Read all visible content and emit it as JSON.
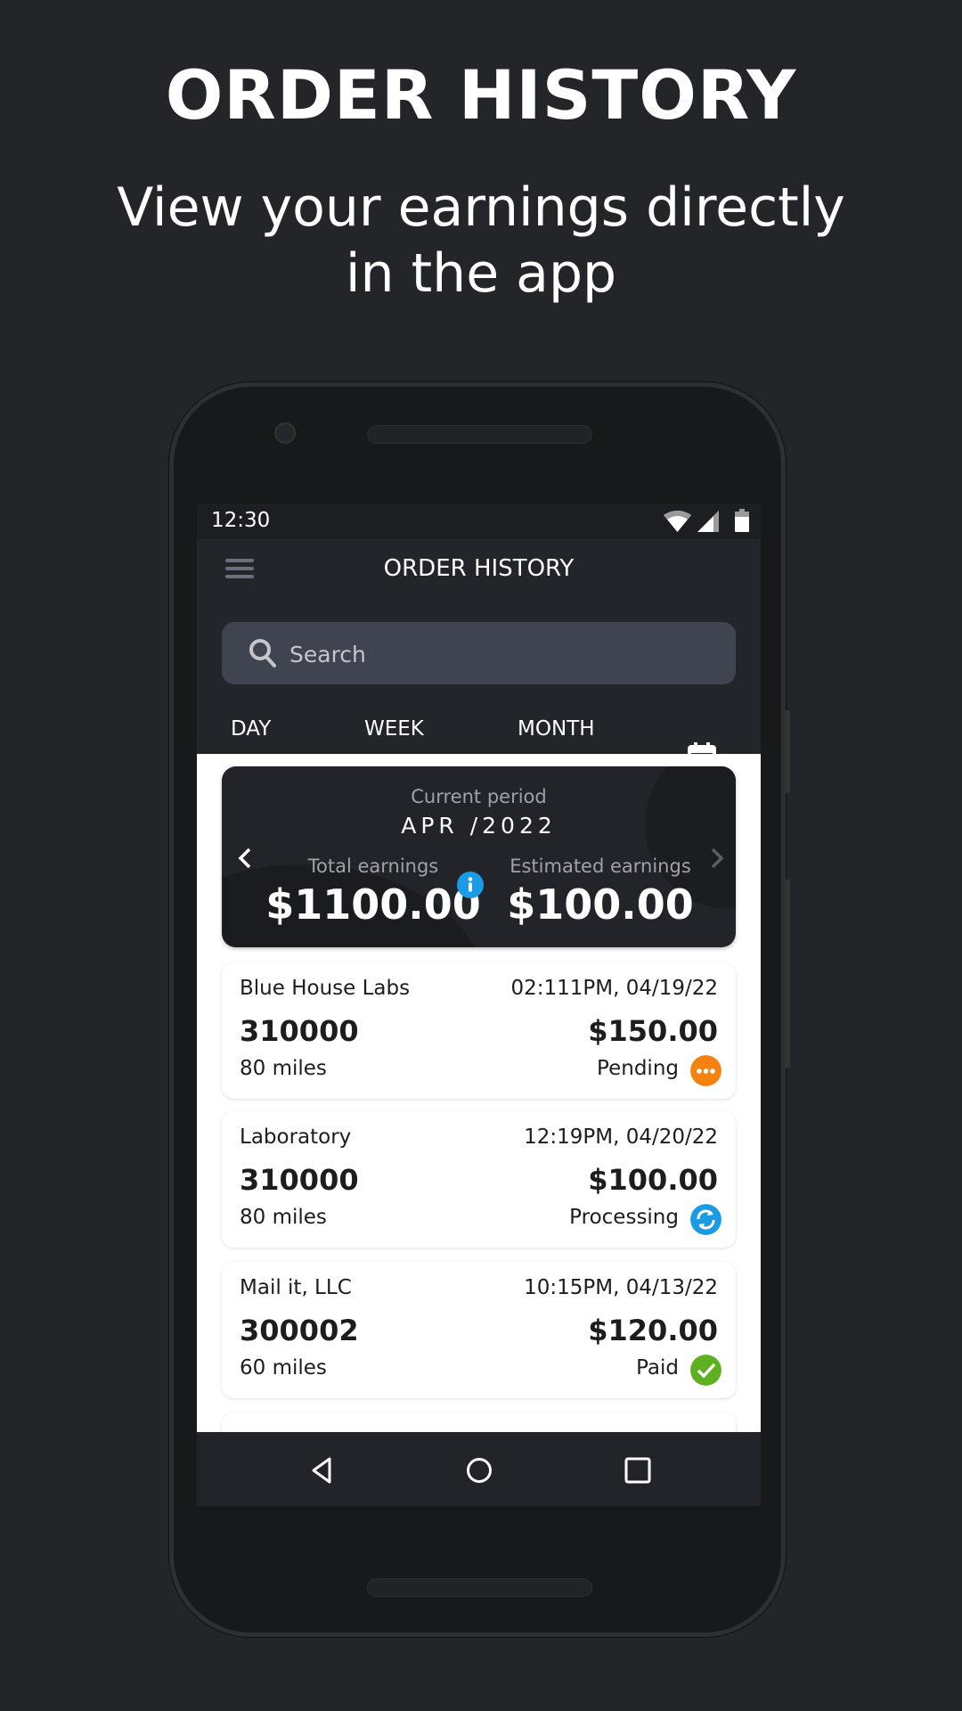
{
  "promo": {
    "headline": "ORDER HISTORY",
    "subline_1": "View your earnings directly",
    "subline_2": "in the app"
  },
  "status_bar": {
    "time": "12:30",
    "icons": [
      "wifi-icon",
      "signal-icon",
      "battery-icon"
    ]
  },
  "app_bar": {
    "title": "ORDER HISTORY",
    "menu_icon": "hamburger-menu-icon"
  },
  "search": {
    "placeholder": "Search",
    "value": ""
  },
  "tabs": [
    {
      "label": "DAY",
      "active": false
    },
    {
      "label": "WEEK",
      "active": false
    },
    {
      "label": "MONTH",
      "active": true
    }
  ],
  "calendar_icon": "calendar-icon",
  "summary": {
    "period_label": "Current period",
    "period_value": "APR /2022",
    "total_label": "Total earnings",
    "total_value": "$1100.00",
    "estimated_label": "Estimated earnings",
    "estimated_value": "$100.00"
  },
  "orders": [
    {
      "name": "Blue House Labs",
      "time": "02:111PM, 04/19/22",
      "id": "310000",
      "amount": "$150.00",
      "miles": "80 miles",
      "status": "Pending",
      "status_color": "#f5820f"
    },
    {
      "name": "Laboratory",
      "time": "12:19PM, 04/20/22",
      "id": "310000",
      "amount": "$100.00",
      "miles": "80 miles",
      "status": "Processing",
      "status_color": "#1a9be6"
    },
    {
      "name": "Mail it, LLC",
      "time": "10:15PM, 04/13/22",
      "id": "300002",
      "amount": "$120.00",
      "miles": "60 miles",
      "status": "Paid",
      "status_color": "#5fb021"
    }
  ],
  "colors": {
    "accent": "#5fb021",
    "info": "#1a9be6",
    "background": "#232529"
  }
}
